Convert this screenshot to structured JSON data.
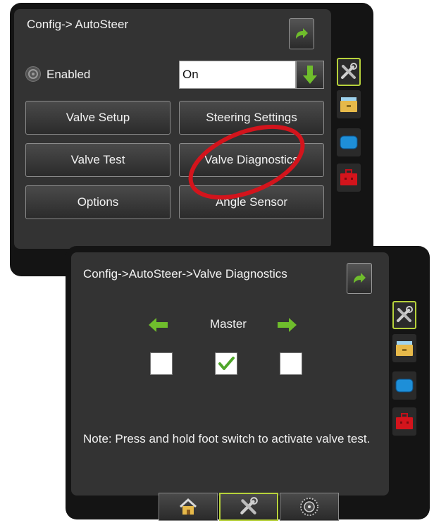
{
  "screen1": {
    "title": "Config-> AutoSteer",
    "enabled_label": "Enabled",
    "enabled_value": "On",
    "buttons": [
      "Valve Setup",
      "Steering Settings",
      "Valve Test",
      "Valve Diagnostics",
      "Options",
      "Angle Sensor"
    ]
  },
  "screen2": {
    "title": "Config->AutoSteer->Valve Diagnostics",
    "master_label": "Master",
    "checkboxes": [
      false,
      true,
      false
    ],
    "note": "Note: Press and hold foot switch to activate valve test."
  },
  "side_tabs": [
    "tools-icon",
    "folder-icon",
    "display-icon",
    "toolbox-icon"
  ],
  "bottom_tabs": [
    "home-icon",
    "tools-icon",
    "gauge-icon"
  ],
  "colors": {
    "accent_green": "#6fbd2c",
    "active_border": "#b7d23b",
    "highlight_ring": "#d3141c"
  }
}
